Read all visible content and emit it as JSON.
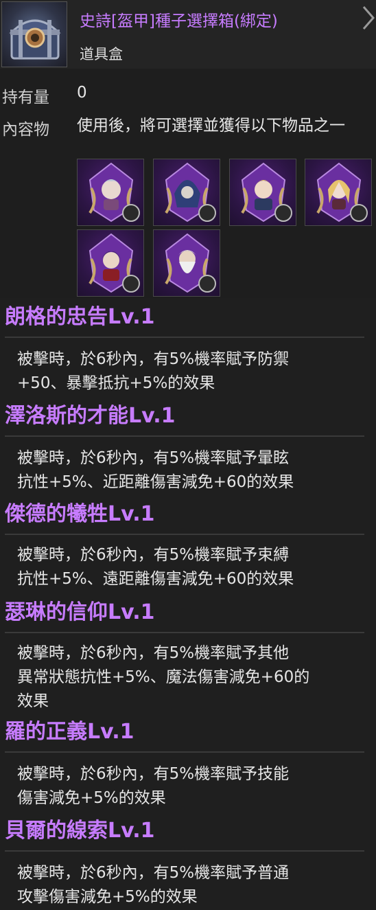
{
  "item": {
    "name": "史詩[盔甲]種子選擇箱(綁定)",
    "type": "道具盒",
    "icon": "treasure-chest-icon",
    "name_color": "#c77cff"
  },
  "quantity": {
    "label": "持有量",
    "value": "0"
  },
  "contents": {
    "label": "內容物",
    "description": "使用後，將可選擇並獲得以下物品之一",
    "items": [
      {
        "icon": "portrait-silver-haired-girl-icon",
        "badge": "shield-badge-icon"
      },
      {
        "icon": "portrait-blue-hooded-figure-icon",
        "badge": "skull-badge-icon"
      },
      {
        "icon": "portrait-blonde-young-man-icon",
        "badge": "crossed-swords-badge-icon"
      },
      {
        "icon": "portrait-blonde-girl-icon",
        "badge": "mask-badge-icon"
      },
      {
        "icon": "portrait-dark-haired-boy-icon",
        "badge": "shield-badge-icon"
      },
      {
        "icon": "portrait-white-bearded-elder-icon",
        "badge": "scroll-badge-icon"
      }
    ]
  },
  "skills": [
    {
      "title": "朗格的忠告Lv.1",
      "lines": [
        "被擊時，於6秒內，有5%機率賦予防禦",
        "+50、暴擊抵抗+5%的效果"
      ]
    },
    {
      "title": "澤洛斯的才能Lv.1",
      "lines": [
        "被擊時，於6秒內，有5%機率賦予暈眩",
        "抗性+5%、近距離傷害減免+60的效果"
      ]
    },
    {
      "title": "傑德的犧牲Lv.1",
      "lines": [
        "被擊時，於6秒內，有5%機率賦予束縛",
        "抗性+5%、遠距離傷害減免+60的效果"
      ]
    },
    {
      "title": "瑟琳的信仰Lv.1",
      "lines": [
        "被擊時，於6秒內，有5%機率賦予其他",
        "異常狀態抗性+5%、魔法傷害減免+60的",
        "效果"
      ]
    },
    {
      "title": "羅的正義Lv.1",
      "lines": [
        "被擊時，於6秒內，有5%機率賦予技能",
        "傷害減免+5%的效果"
      ]
    },
    {
      "title": "貝爾的線索Lv.1",
      "lines": [
        "被擊時，於6秒內，有5%機率賦予普通",
        "攻擊傷害減免+5%的效果"
      ]
    }
  ]
}
